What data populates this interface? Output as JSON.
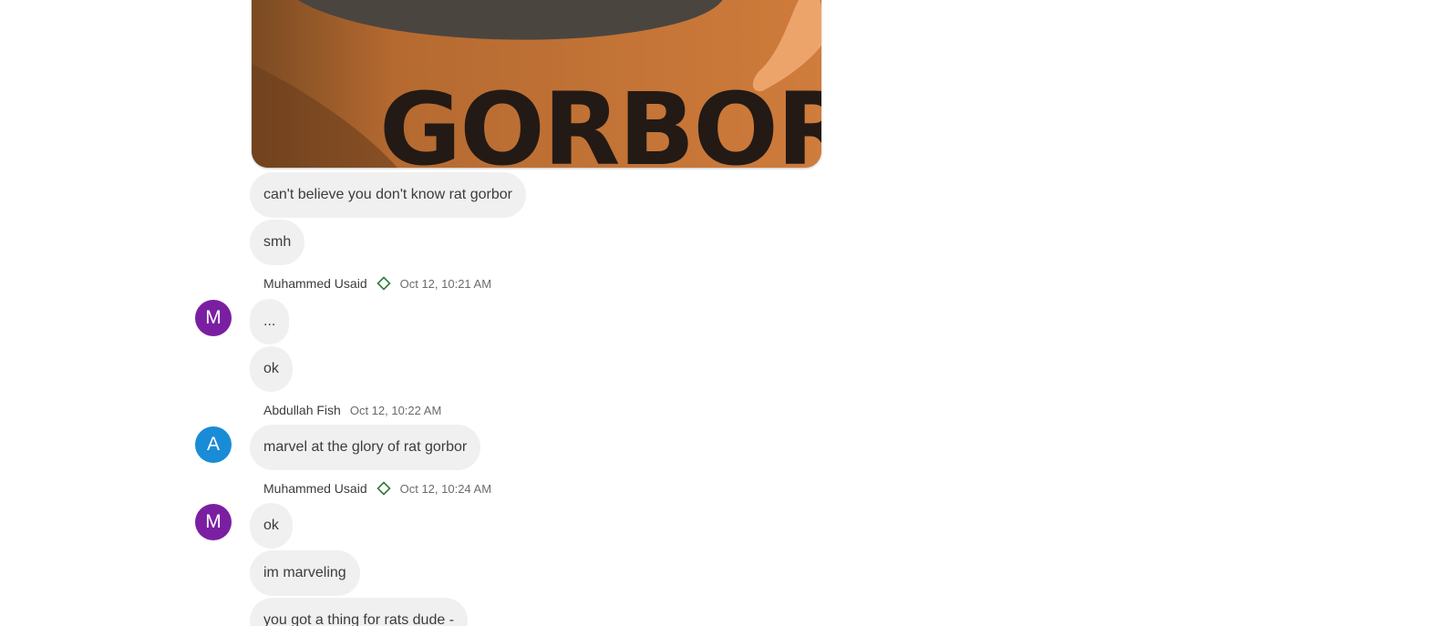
{
  "colors": {
    "bubble_bg": "#f0f0f0",
    "avatar_m": "#7b1fa2",
    "avatar_a": "#1a8bd6",
    "diamond": "#2e7d32"
  },
  "image_attachment": {
    "text": "GORBOR"
  },
  "messages_top": [
    "can't believe you don't know rat gorbor",
    "smh"
  ],
  "group1": {
    "sender": "Muhammed Usaid",
    "avatar_letter": "M",
    "timestamp": "Oct 12, 10:21 AM",
    "messages": [
      "...",
      "ok"
    ]
  },
  "group2": {
    "sender": "Abdullah Fish",
    "avatar_letter": "A",
    "timestamp": "Oct 12, 10:22 AM",
    "messages": [
      "marvel at the glory of rat gorbor"
    ]
  },
  "group3": {
    "sender": "Muhammed Usaid",
    "avatar_letter": "M",
    "timestamp": "Oct 12, 10:24 AM",
    "messages": [
      "ok",
      "im marveling",
      "you got a thing for rats dude -"
    ]
  }
}
